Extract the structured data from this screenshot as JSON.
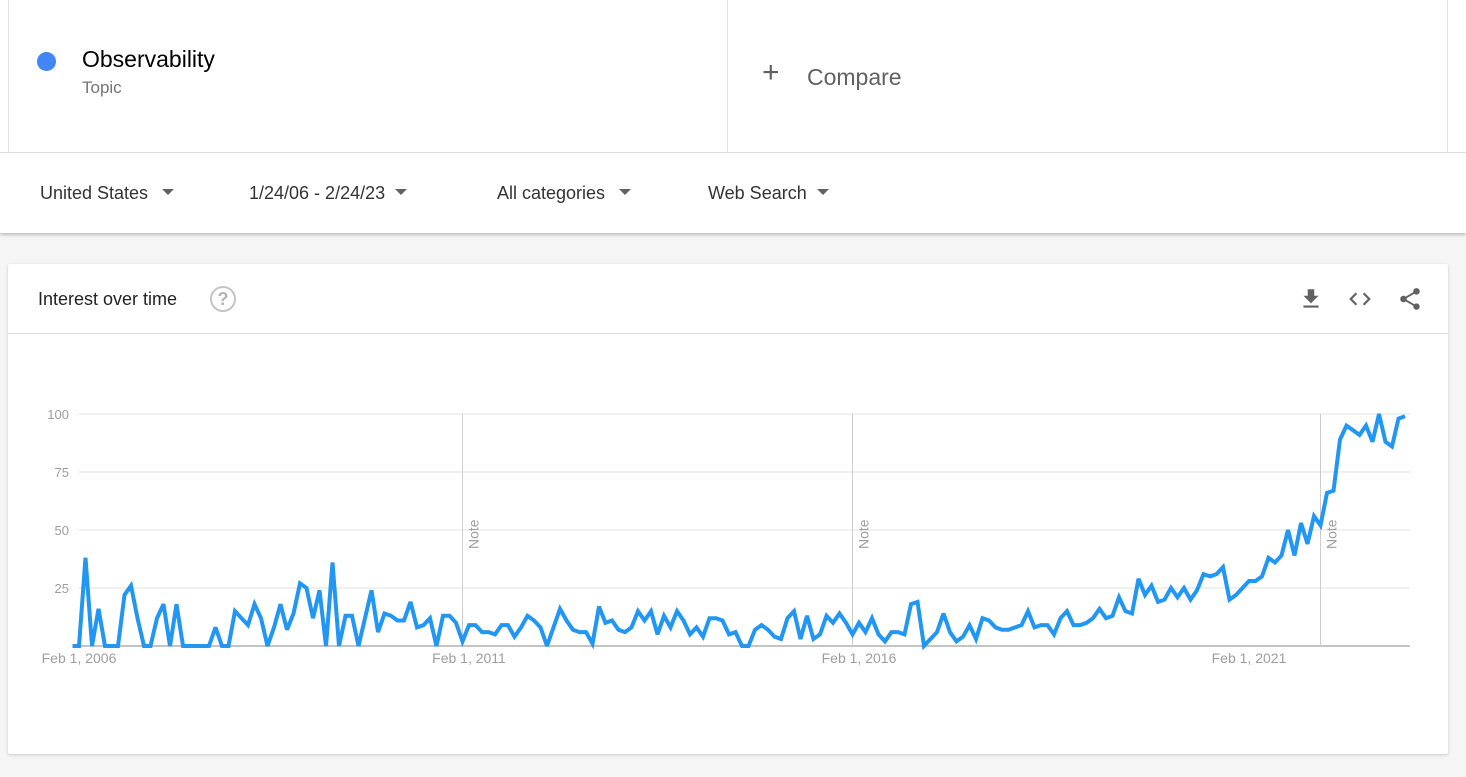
{
  "term": {
    "name": "Observability",
    "type": "Topic",
    "color": "#4285f4"
  },
  "compare": {
    "icon": "plus-icon",
    "label": "Compare"
  },
  "filters": [
    {
      "label": "United States"
    },
    {
      "label": "1/24/06 - 2/24/23"
    },
    {
      "label": "All categories"
    },
    {
      "label": "Web Search"
    }
  ],
  "card": {
    "title": "Interest over time",
    "help_icon": "help-circle-icon",
    "help_glyph": "?",
    "actions": [
      {
        "name": "download-icon"
      },
      {
        "name": "embed-code-icon"
      },
      {
        "name": "share-icon"
      }
    ]
  },
  "chart_data": {
    "type": "line",
    "title": "Interest over time",
    "xlabel": "",
    "ylabel": "",
    "ylim": [
      0,
      100
    ],
    "yticks": [
      100,
      75,
      50,
      25
    ],
    "grid": true,
    "line_color": "#2196f3",
    "x_start": "2006-01",
    "x_end": "2023-02",
    "x_ticks": [
      {
        "label": "Feb 1, 2006",
        "month_index": 1
      },
      {
        "label": "Feb 1, 2011",
        "month_index": 61
      },
      {
        "label": "Feb 1, 2016",
        "month_index": 121
      },
      {
        "label": "Feb 1, 2021",
        "month_index": 181
      }
    ],
    "notes": [
      {
        "label": "Note",
        "month_index": 60
      },
      {
        "label": "Note",
        "month_index": 120
      },
      {
        "label": "Note",
        "month_index": 192
      }
    ],
    "series": [
      {
        "name": "Observability",
        "values": [
          0,
          0,
          38,
          0,
          16,
          0,
          0,
          0,
          22,
          26,
          12,
          0,
          0,
          12,
          18,
          0,
          18,
          0,
          0,
          0,
          0,
          0,
          8,
          0,
          0,
          15,
          12,
          9,
          18,
          12,
          0,
          8,
          18,
          7,
          14,
          27,
          25,
          12,
          24,
          0,
          36,
          0,
          13,
          13,
          0,
          12,
          24,
          6,
          14,
          13,
          11,
          11,
          19,
          8,
          9,
          12,
          0,
          13,
          13,
          10,
          2,
          9,
          9,
          6,
          6,
          5,
          9,
          9,
          4,
          8,
          13,
          11,
          8,
          0,
          8,
          16,
          11,
          7,
          6,
          6,
          1,
          17,
          10,
          11,
          7,
          6,
          8,
          15,
          11,
          15,
          5,
          13,
          8,
          15,
          11,
          5,
          8,
          4,
          12,
          12,
          11,
          5,
          6,
          0,
          0,
          7,
          9,
          7,
          4,
          3,
          12,
          15,
          3,
          13,
          3,
          5,
          13,
          10,
          14,
          10,
          5,
          10,
          6,
          12,
          5,
          2,
          6,
          6,
          5,
          18,
          19,
          0,
          3,
          6,
          14,
          6,
          2,
          4,
          9,
          3,
          12,
          11,
          8,
          7,
          7,
          8,
          9,
          15,
          8,
          9,
          9,
          5,
          12,
          15,
          9,
          9,
          10,
          12,
          16,
          12,
          13,
          21,
          15,
          14,
          29,
          22,
          26,
          19,
          20,
          25,
          21,
          25,
          20,
          24,
          31,
          30,
          31,
          34,
          20,
          22,
          25,
          28,
          28,
          30,
          38,
          36,
          39,
          50,
          39,
          53,
          44,
          56,
          52,
          66,
          67,
          89,
          95,
          93,
          91,
          95,
          88,
          100,
          88,
          86,
          98,
          99
        ]
      }
    ]
  }
}
